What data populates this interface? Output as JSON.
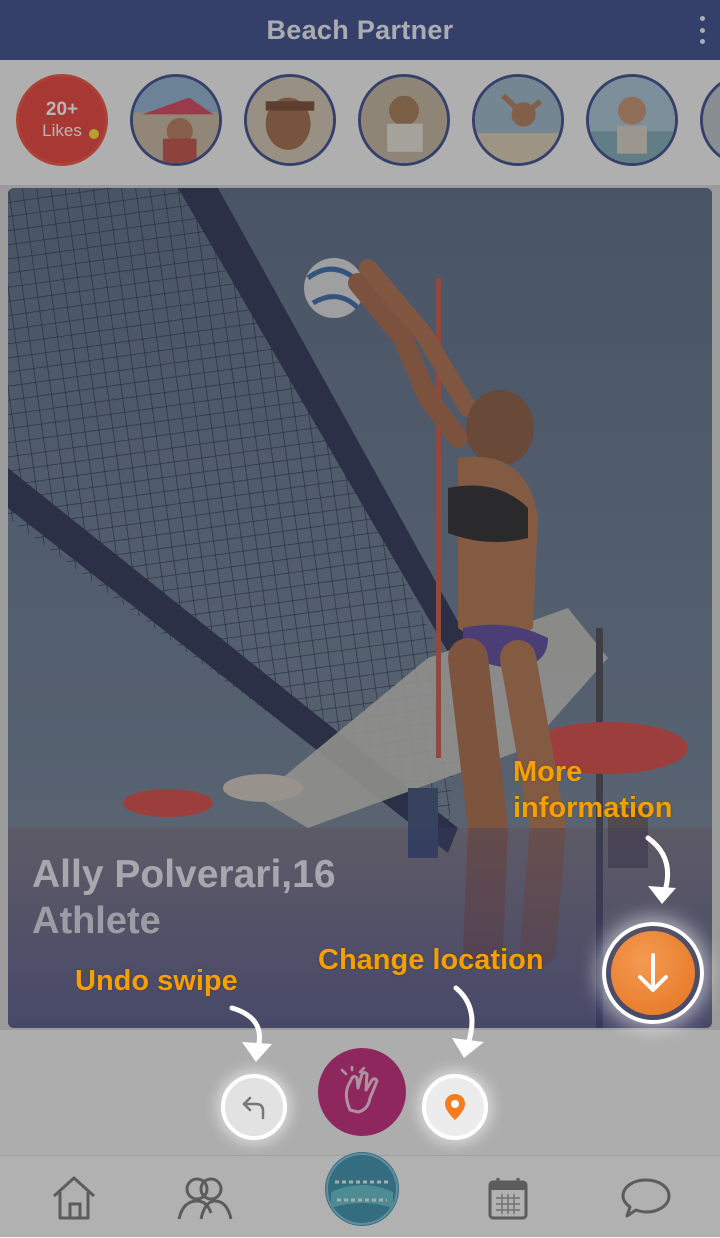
{
  "header": {
    "title": "Beach Partner",
    "menu_icon": "kebab-menu-icon"
  },
  "stories": {
    "likes": {
      "count": "20+",
      "label": "Likes"
    },
    "profiles": 6
  },
  "card": {
    "name": "Ally Polverari,16",
    "role": "Athlete",
    "photo_subject": "beach volleyball player blocking at the net"
  },
  "actions": {
    "undo_icon": "undo-arrow-icon",
    "clap_icon": "clapping-hands-icon",
    "location_icon": "map-pin-icon",
    "more_info_icon": "arrow-down-icon"
  },
  "tabbar": {
    "tabs": [
      "home-icon",
      "people-icon",
      "beach-partner-logo",
      "calendar-icon",
      "chat-bubble-icon"
    ]
  },
  "coach_marks": {
    "more_info_line1": "More",
    "more_info_line2": "information",
    "change_location": "Change location",
    "undo_swipe": "Undo swipe"
  },
  "colors": {
    "header": "#3b4b8c",
    "coach_text": "#f5a000",
    "more_info_button": "#ea7a2a",
    "location_pin": "#f47d20",
    "clap_button": "#c4267c"
  }
}
